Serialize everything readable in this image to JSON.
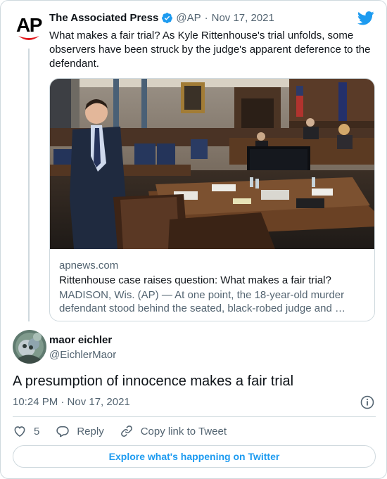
{
  "colors": {
    "accent": "#1d9bf0",
    "text": "#0f1419",
    "muted": "#536471",
    "border": "#cfd9de",
    "ap_red": "#e21a1f"
  },
  "brand_icon": "twitter-bird-icon",
  "parent_tweet": {
    "logo_text": "AP",
    "author_name": "The Associated Press",
    "verified_icon": "verified-badge-icon",
    "handle": "@AP",
    "separator": "·",
    "date": "Nov 17, 2021",
    "text": "What makes a fair trial? As Kyle Rittenhouse's trial unfolds, some observers have been struck by the judge's apparent deference to the defendant.",
    "link_card": {
      "image_icon": "courtroom-photo",
      "domain": "apnews.com",
      "title": "Rittenhouse case raises question: What makes a fair trial?",
      "description": "MADISON, Wis. (AP) — At one point, the 18-year-old murder defendant stood behind the seated, black-robed judge and …"
    }
  },
  "reply_tweet": {
    "avatar_icon": "user-avatar",
    "author_name": "maor eichler",
    "handle": "@EichlerMaor",
    "text": "A presumption of innocence makes a fair trial",
    "timestamp": "10:24 PM · Nov 17, 2021",
    "info_icon": "info-icon"
  },
  "actions": {
    "like_icon": "heart-icon",
    "like_count": "5",
    "reply_icon": "reply-bubble-icon",
    "reply_label": "Reply",
    "copy_icon": "link-icon",
    "copy_label": "Copy link to Tweet"
  },
  "explore_label": "Explore what's happening on Twitter"
}
